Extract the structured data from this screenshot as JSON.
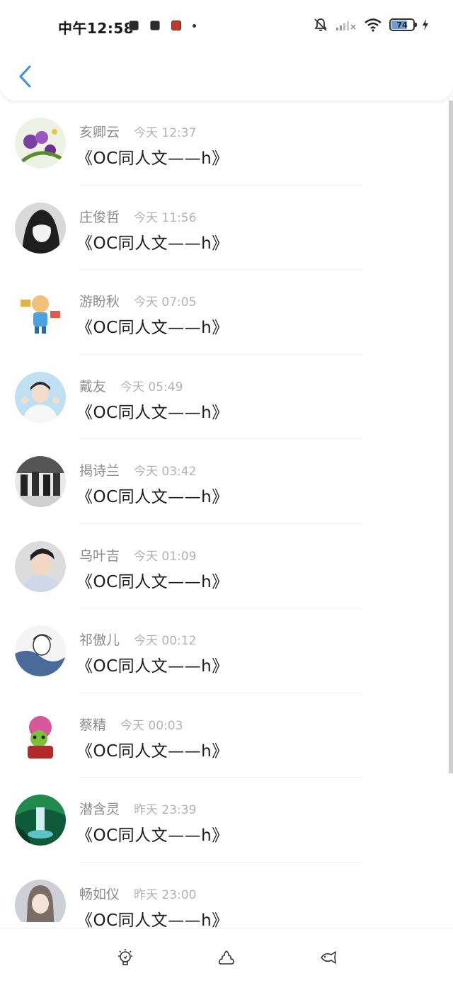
{
  "status_bar": {
    "time": "中午12:58",
    "battery": "74",
    "notification_icons": [
      "app-icon",
      "app-icon",
      "app-icon-red"
    ],
    "system_icons": [
      "mute-bell-icon",
      "signal-icon",
      "wifi-icon",
      "battery-icon",
      "charging-icon"
    ]
  },
  "header": {
    "back_icon": "chevron-left-icon",
    "accent": "#3a8fe0"
  },
  "items": [
    {
      "name": "亥卿云",
      "time": "今天 12:37",
      "title": "《OC同人文——h》"
    },
    {
      "name": "庄俊哲",
      "time": "今天 11:56",
      "title": "《OC同人文——h》"
    },
    {
      "name": "游盼秋",
      "time": "今天 07:05",
      "title": "《OC同人文——h》"
    },
    {
      "name": "戴友",
      "time": "今天 05:49",
      "title": "《OC同人文——h》"
    },
    {
      "name": "揭诗兰",
      "time": "今天 03:42",
      "title": "《OC同人文——h》"
    },
    {
      "name": "乌叶吉",
      "time": "今天 01:09",
      "title": "《OC同人文——h》"
    },
    {
      "name": "祁傲儿",
      "time": "今天 00:12",
      "title": "《OC同人文——h》"
    },
    {
      "name": "蔡精",
      "time": "今天 00:03",
      "title": "《OC同人文——h》"
    },
    {
      "name": "潜含灵",
      "time": "昨天 23:39",
      "title": "《OC同人文——h》"
    },
    {
      "name": "畅如仪",
      "time": "昨天 23:00",
      "title": "《OC同人文——h》"
    }
  ],
  "bottom_bar": {
    "icons": [
      "lightbulb-icon",
      "poop-icon",
      "fish-icon"
    ]
  }
}
